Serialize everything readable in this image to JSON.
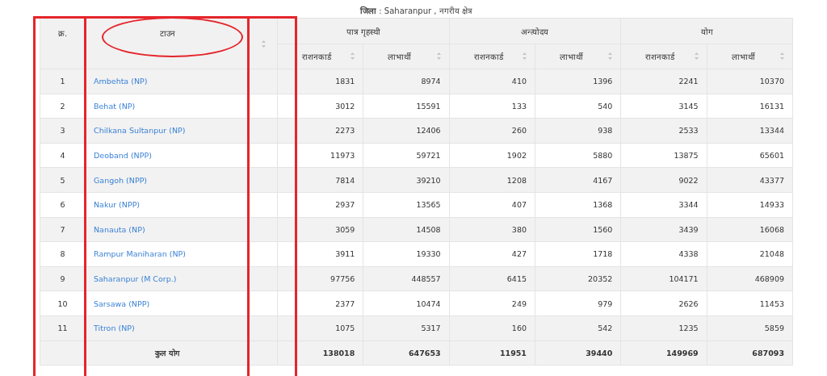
{
  "title": "**जिला** : Saharanpur  , नगरीय क्षेत्र",
  "header": {
    "number": "क्र.",
    "town": "टाउन",
    "groups": [
      "पात्र गृहस्थी",
      "अन्त्योदय",
      "योग"
    ],
    "subcolumns": [
      "राशनकार्ड",
      "लाभार्थी",
      "राशनकार्ड",
      "लाभार्थी",
      "राशनकार्ड",
      "लाभार्थी"
    ]
  },
  "rows": [
    {
      "number": "1",
      "town": "Ambehta (NP)",
      "values": [
        "1831",
        "8974",
        "410",
        "1396",
        "2241",
        "10370"
      ]
    },
    {
      "number": "2",
      "town": "Behat (NP)",
      "values": [
        "3012",
        "15591",
        "133",
        "540",
        "3145",
        "16131"
      ]
    },
    {
      "number": "3",
      "town": "Chilkana Sultanpur (NP)",
      "values": [
        "2273",
        "12406",
        "260",
        "938",
        "2533",
        "13344"
      ]
    },
    {
      "number": "4",
      "town": "Deoband (NPP)",
      "values": [
        "11973",
        "59721",
        "1902",
        "5880",
        "13875",
        "65601"
      ]
    },
    {
      "number": "5",
      "town": "Gangoh (NPP)",
      "values": [
        "7814",
        "39210",
        "1208",
        "4167",
        "9022",
        "43377"
      ]
    },
    {
      "number": "6",
      "town": "Nakur (NPP)",
      "values": [
        "2937",
        "13565",
        "407",
        "1368",
        "3344",
        "14933"
      ]
    },
    {
      "number": "7",
      "town": "Nanauta (NP)",
      "values": [
        "3059",
        "14508",
        "380",
        "1560",
        "3439",
        "16068"
      ]
    },
    {
      "number": "8",
      "town": "Rampur Maniharan (NP)",
      "values": [
        "3911",
        "19330",
        "427",
        "1718",
        "4338",
        "21048"
      ]
    },
    {
      "number": "9",
      "town": "Saharanpur (M Corp.)",
      "values": [
        "97756",
        "448557",
        "6415",
        "20352",
        "104171",
        "468909"
      ]
    },
    {
      "number": "10",
      "town": "Sarsawa (NPP)",
      "values": [
        "2377",
        "10474",
        "249",
        "979",
        "2626",
        "11453"
      ]
    },
    {
      "number": "11",
      "town": "Titron (NP)",
      "values": [
        "1075",
        "5317",
        "160",
        "542",
        "1235",
        "5859"
      ]
    }
  ],
  "total": {
    "label": "कुल योग",
    "values": [
      "138018",
      "647653",
      "11951",
      "39440",
      "149969",
      "687093"
    ]
  },
  "annotations": [
    {
      "kind": "outer-frame"
    },
    {
      "kind": "town-frame"
    },
    {
      "kind": "header-ellipse"
    }
  ]
}
